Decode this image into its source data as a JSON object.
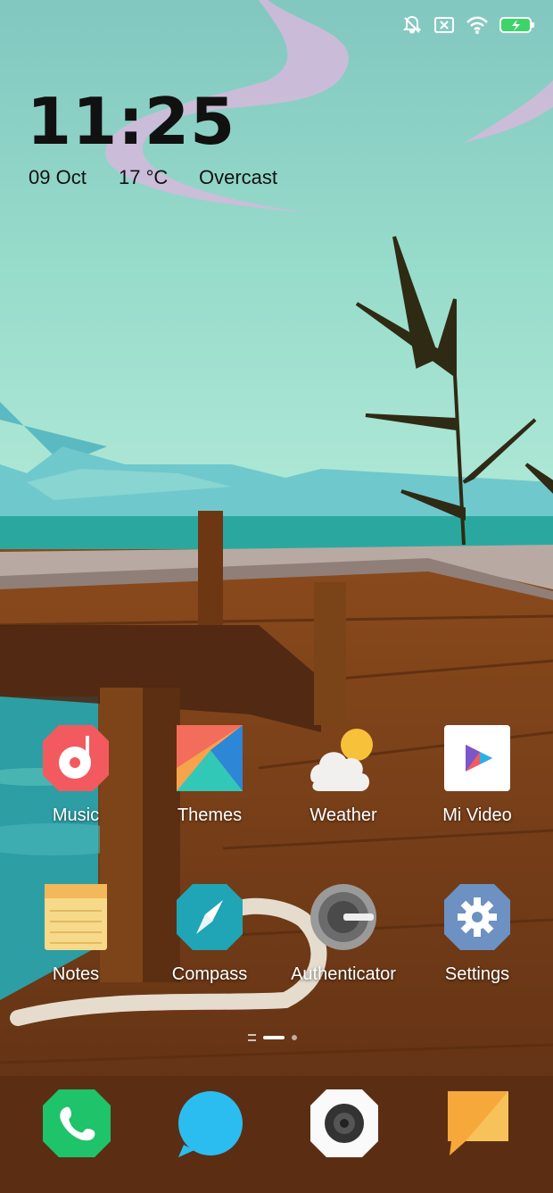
{
  "clock": {
    "time": "11:25",
    "date": "09 Oct",
    "temperature": "17 °C",
    "condition": "Overcast"
  },
  "status_bar": {
    "icons": [
      "bell-off-icon",
      "no-sim-icon",
      "wifi-icon",
      "battery-charging-icon"
    ]
  },
  "apps": [
    {
      "label": "Music",
      "icon": "music-icon"
    },
    {
      "label": "Themes",
      "icon": "themes-icon"
    },
    {
      "label": "Weather",
      "icon": "weather-icon"
    },
    {
      "label": "Mi Video",
      "icon": "video-play-icon"
    },
    {
      "label": "Notes",
      "icon": "notes-icon"
    },
    {
      "label": "Compass",
      "icon": "compass-icon"
    },
    {
      "label": "Authenticator",
      "icon": "authenticator-icon"
    },
    {
      "label": "Settings",
      "icon": "gear-icon"
    }
  ],
  "dock": [
    {
      "icon": "phone-icon"
    },
    {
      "icon": "messaging-icon"
    },
    {
      "icon": "camera-icon"
    },
    {
      "icon": "chat-icon"
    }
  ],
  "colors": {
    "sky": "#9fe0cf",
    "water": "#2aa8a0",
    "wood": "#7a4318",
    "music": "#f25a5f",
    "phone": "#1ec36a",
    "messaging": "#2bbdf0",
    "chat": "#f6a93a",
    "settings": "#6c91c2",
    "compass": "#1fa5b5"
  }
}
